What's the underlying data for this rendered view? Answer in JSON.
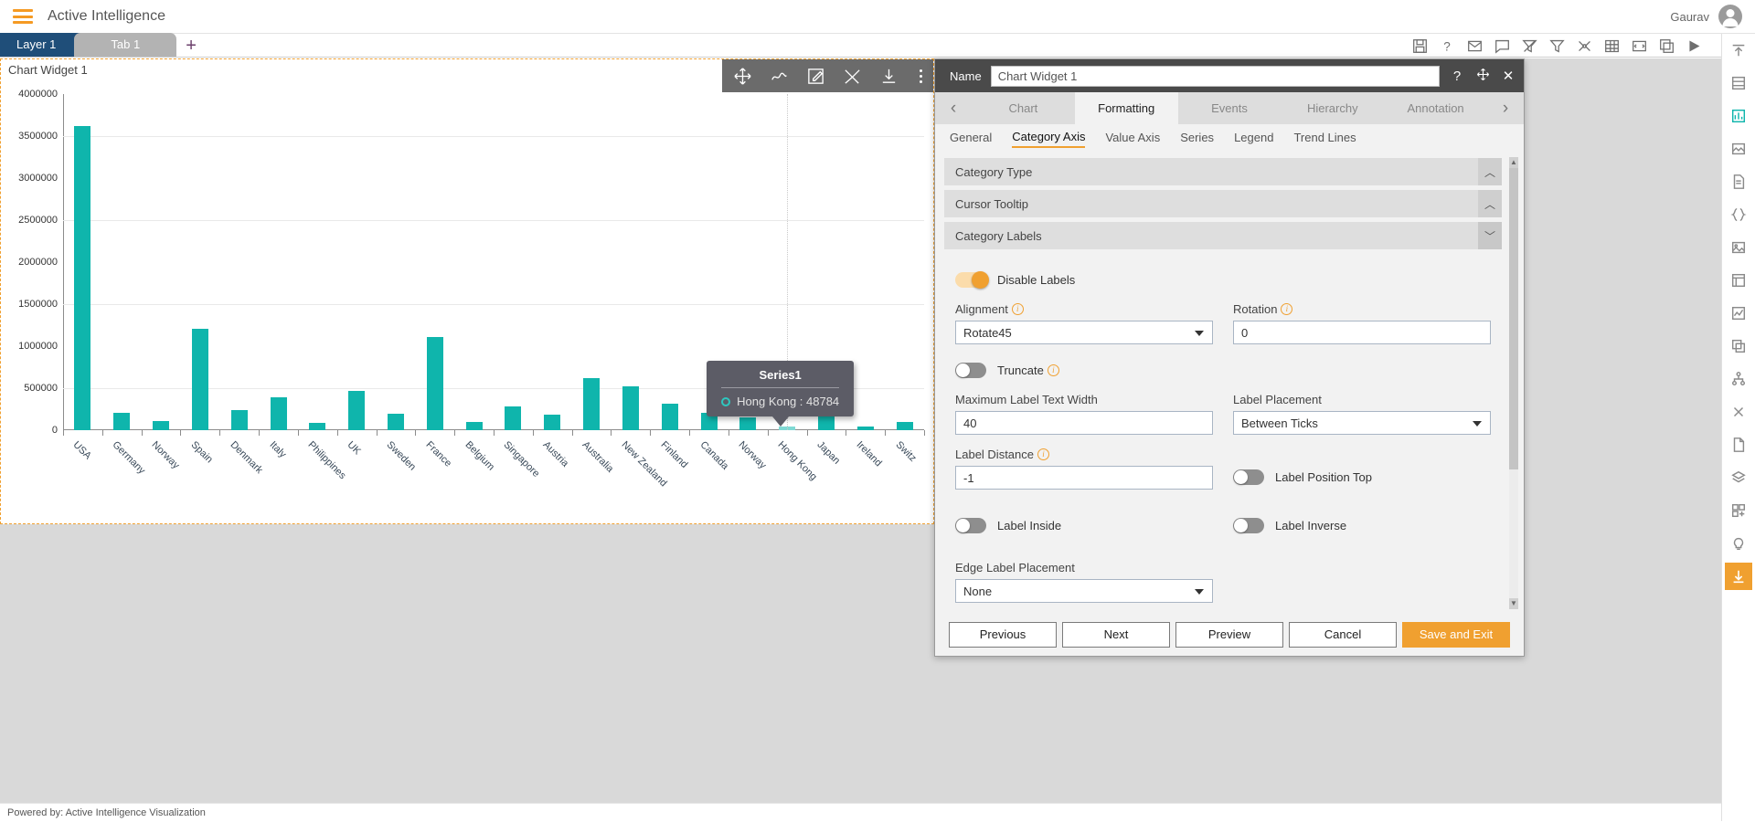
{
  "app": {
    "title": "Active Intelligence",
    "user": "Gaurav",
    "menu_icon": "hamburger-icon",
    "avatar_icon": "user-avatar-icon"
  },
  "tabs": {
    "layer": "Layer 1",
    "page": "Tab 1",
    "add": "+",
    "toolbar_icons": [
      "save-icon",
      "help-icon",
      "mail-icon",
      "comment-icon",
      "filter-off-icon",
      "filter-icon",
      "settings-icon",
      "table-icon",
      "code-icon",
      "copy-icon",
      "play-icon"
    ]
  },
  "widget": {
    "title": "Chart Widget 1",
    "toolbar_icons": [
      "move-icon",
      "scribble-icon",
      "edit-icon",
      "tools-icon",
      "download-icon",
      "more-options-icon"
    ]
  },
  "footer": {
    "text": "Powered by: Active Intelligence Visualization"
  },
  "rail": {
    "items": [
      "collapse-up-icon",
      "list-icon",
      "chart-bar-icon",
      "image-map-icon",
      "document-icon",
      "code-braces-icon",
      "picture-icon",
      "grid-icon",
      "line-chart-icon",
      "layers-copy-icon",
      "hierarchy-icon",
      "function-icon",
      "file-icon",
      "stack-icon",
      "widget-add-icon",
      "bulb-icon",
      "download-arrow-icon"
    ]
  },
  "dialog": {
    "name_label": "Name",
    "name_value": "Chart Widget 1",
    "header_icons": [
      "help-icon",
      "move-icon",
      "close-icon"
    ],
    "nav_prev_icon": "chevron-left-icon",
    "nav_next_icon": "chevron-right-icon",
    "tabs": [
      {
        "label": "Chart",
        "selected": false
      },
      {
        "label": "Formatting",
        "selected": true
      },
      {
        "label": "Events",
        "selected": false
      },
      {
        "label": "Hierarchy",
        "selected": false
      },
      {
        "label": "Annotation",
        "selected": false
      }
    ],
    "subtabs": [
      {
        "label": "General",
        "selected": false
      },
      {
        "label": "Category Axis",
        "selected": true
      },
      {
        "label": "Value Axis",
        "selected": false
      },
      {
        "label": "Series",
        "selected": false
      },
      {
        "label": "Legend",
        "selected": false
      },
      {
        "label": "Trend Lines",
        "selected": false
      }
    ],
    "accordions": [
      {
        "title": "Category Type",
        "open": false,
        "chevron": "chevron-up-icon"
      },
      {
        "title": "Cursor Tooltip",
        "open": false,
        "chevron": "chevron-up-icon"
      },
      {
        "title": "Category Labels",
        "open": true,
        "chevron": "chevron-down-icon"
      }
    ],
    "fields": {
      "disable_labels": {
        "label": "Disable Labels",
        "on": true
      },
      "alignment": {
        "label": "Alignment",
        "value": "Rotate45",
        "has_info": true
      },
      "rotation": {
        "label": "Rotation",
        "value": "0",
        "has_info": true
      },
      "truncate": {
        "label": "Truncate",
        "on": false,
        "has_info": true
      },
      "max_label_text_width": {
        "label": "Maximum Label Text Width",
        "value": "40"
      },
      "label_placement": {
        "label": "Label Placement",
        "value": "Between Ticks"
      },
      "label_distance": {
        "label": "Label Distance",
        "value": "-1",
        "has_info": true
      },
      "label_position_top": {
        "label": "Label Position Top",
        "on": false
      },
      "label_inside": {
        "label": "Label Inside",
        "on": false
      },
      "label_inverse": {
        "label": "Label Inverse",
        "on": false
      },
      "edge_label_placement": {
        "label": "Edge Label Placement",
        "value": "None"
      }
    },
    "buttons": {
      "previous": "Previous",
      "next": "Next",
      "preview": "Preview",
      "cancel": "Cancel",
      "save": "Save and Exit"
    }
  },
  "tooltip": {
    "title": "Series1",
    "text": "Hong Kong : 48784",
    "marker_color": "#2ec7bf"
  },
  "chart_data": {
    "type": "bar",
    "title": "",
    "xlabel": "",
    "ylabel": "",
    "ylim": [
      0,
      4000000
    ],
    "ytick_labels": [
      "0",
      "500000",
      "1000000",
      "1500000",
      "2000000",
      "2500000",
      "3000000",
      "3500000",
      "4000000"
    ],
    "yticks": [
      0,
      500000,
      1000000,
      1500000,
      2000000,
      2500000,
      3000000,
      3500000,
      4000000
    ],
    "grid": true,
    "legend": "none",
    "series_name": "Series1",
    "bar_color": "#0fb5ac",
    "highlight_color": "#7fd9d4",
    "highlight_category": "Hong Kong",
    "categories": [
      "USA",
      "Germany",
      "Norway",
      "Spain",
      "Denmark",
      "Italy",
      "Philippines",
      "UK",
      "Sweden",
      "France",
      "Belgium",
      "Singapore",
      "Austria",
      "Australia",
      "New Zealand",
      "Finland",
      "Canada",
      "Norway",
      "Hong Kong",
      "Japan",
      "Ireland",
      "Switz"
    ],
    "values": [
      3620000,
      210000,
      105000,
      1205000,
      235000,
      395000,
      85000,
      470000,
      200000,
      1105000,
      100000,
      280000,
      185000,
      615000,
      525000,
      320000,
      205000,
      150000,
      48784,
      255000,
      40000,
      100000
    ]
  }
}
